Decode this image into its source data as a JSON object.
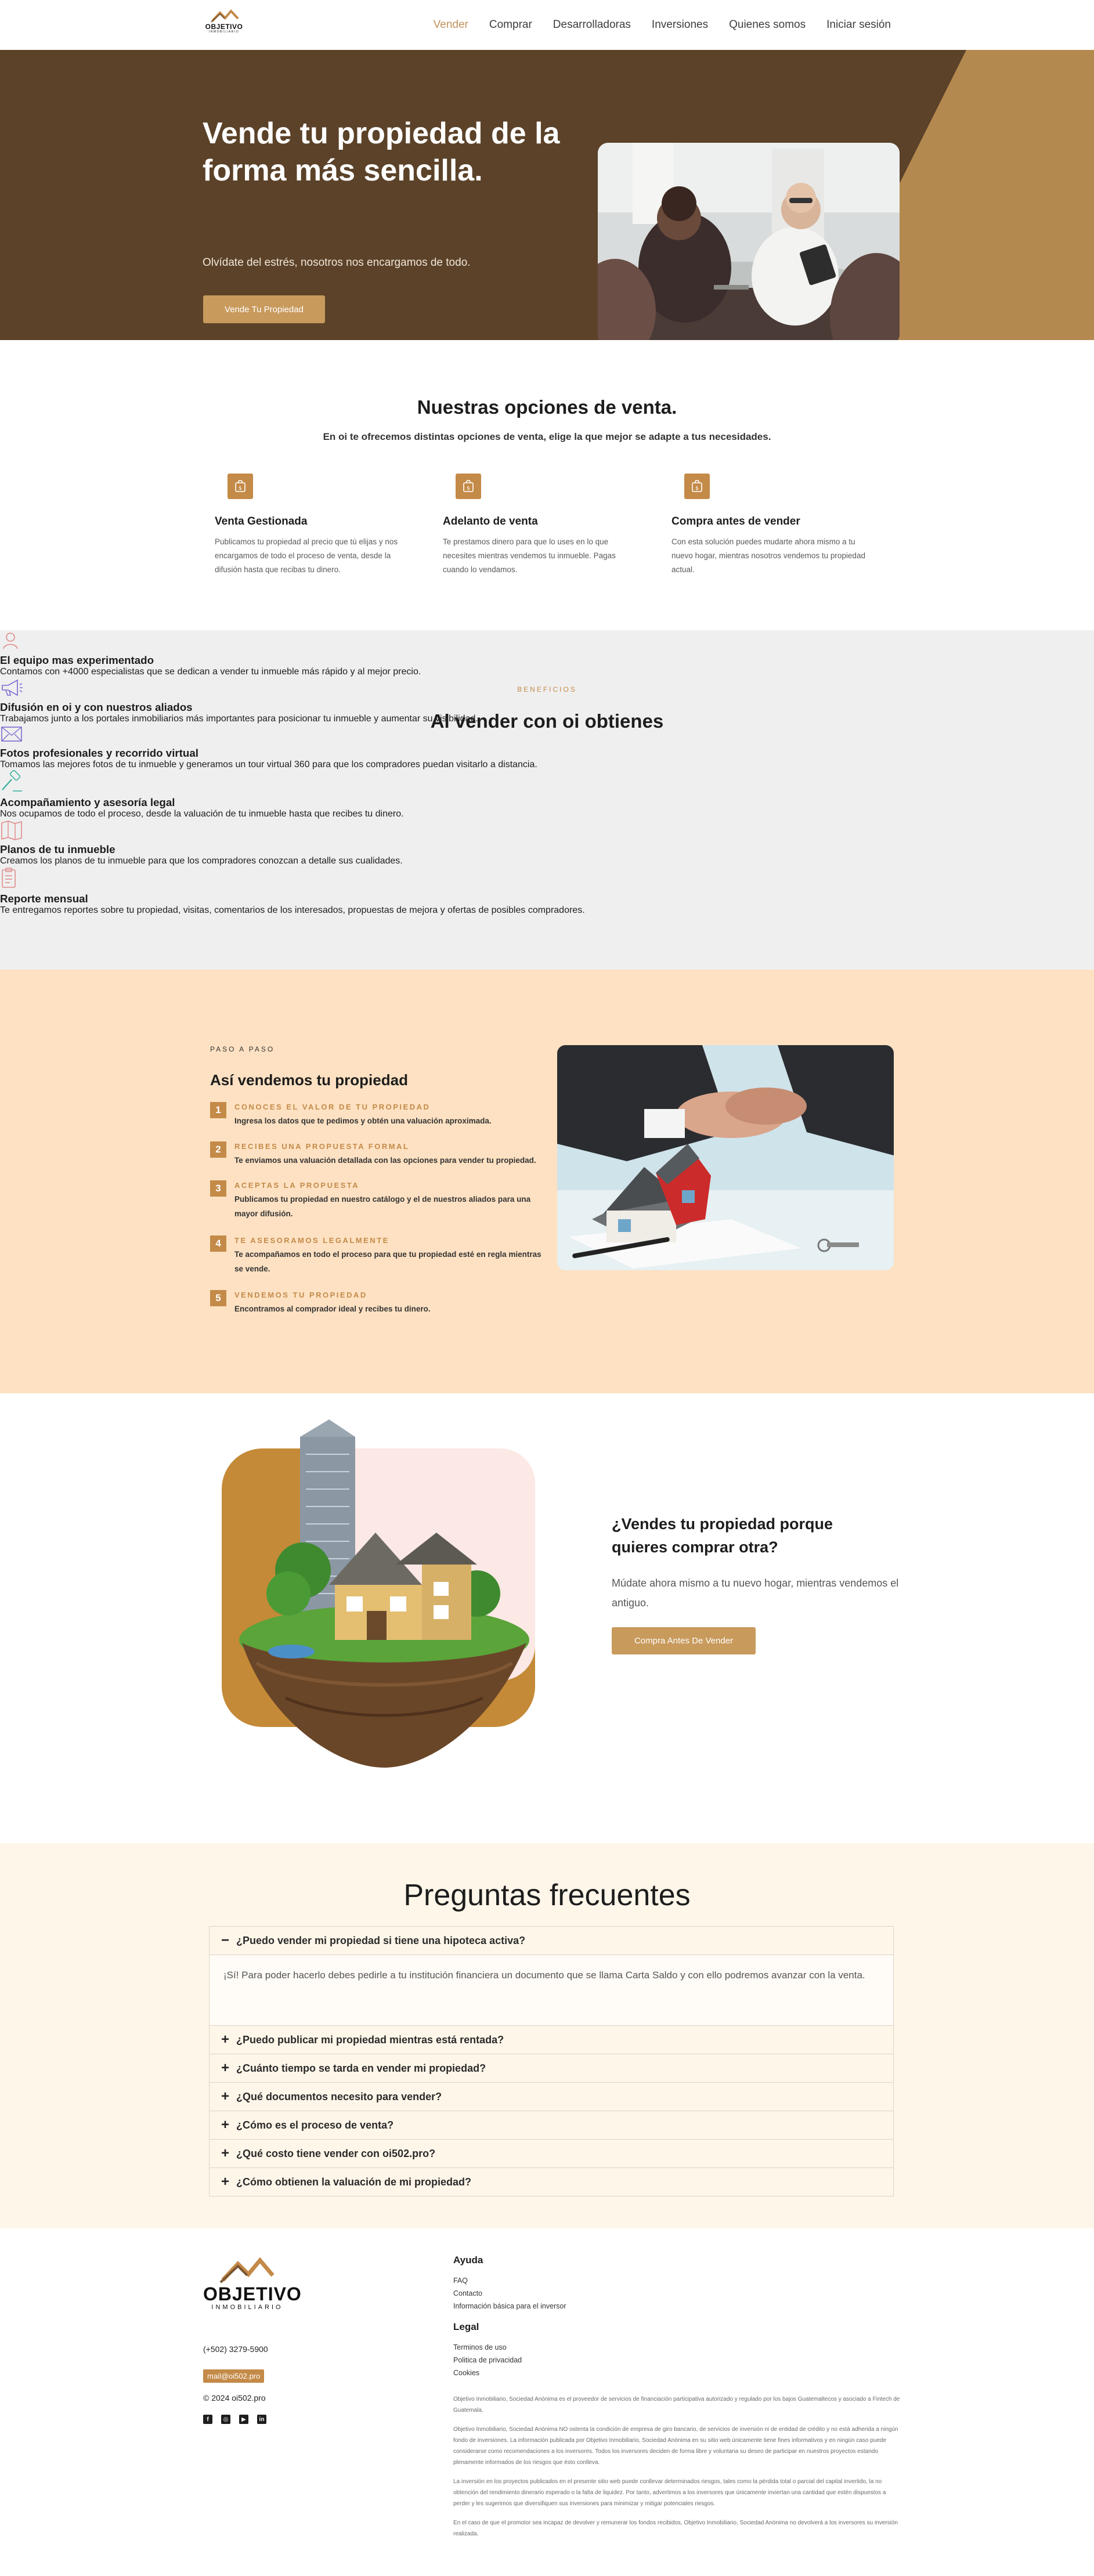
{
  "brand": {
    "name": "OBJETIVO",
    "tagline": "INMOBILIARIO",
    "colors": {
      "gold": "#c48a48",
      "hero_brown": "#5b4229",
      "peach": "#fde1c2",
      "cream": "#fef6e9",
      "grey": "#efefef"
    }
  },
  "nav": {
    "items": [
      {
        "label": "Vender",
        "active": true
      },
      {
        "label": "Comprar"
      },
      {
        "label": "Desarrolladoras"
      },
      {
        "label": "Inversiones"
      },
      {
        "label": "Quienes somos"
      },
      {
        "label": "Iniciar sesión"
      }
    ]
  },
  "hero": {
    "title": "Vende tu propiedad de la forma más sencilla.",
    "subtitle": "Olvídate del estrés, nosotros nos encargamos de todo.",
    "cta": "Vende Tu Propiedad"
  },
  "options": {
    "title": "Nuestras opciones de venta.",
    "lead": "En oi te ofrecemos distintas opciones de venta, elige la que mejor se adapte a tus necesidades.",
    "items": [
      {
        "icon": "money-bag-icon",
        "title": "Venta Gestionada",
        "text": "Publicamos tu propiedad al precio que tú elijas y nos encargamos de todo el proceso de venta, desde la difusión hasta que recibas tu dinero."
      },
      {
        "icon": "money-bag-icon",
        "title": "Adelanto de venta",
        "text": "Te prestamos dinero para que lo uses en lo que necesites mientras vendemos tu inmueble. Pagas cuando lo vendamos."
      },
      {
        "icon": "money-bag-icon",
        "title": "Compra antes de vender",
        "text": "Con esta solución puedes mudarte ahora mismo a tu nuevo hogar, mientras nosotros vendemos tu propiedad actual."
      }
    ]
  },
  "benefits": {
    "kicker": "BENEFICIOS",
    "title": "Al vender con oi obtienes",
    "items": [
      {
        "icon": "user-icon",
        "title": "El equipo mas experimentado",
        "text": "Contamos con +4000 especialistas que se dedican a vender tu inmueble más rápido y al mejor precio."
      },
      {
        "icon": "megaphone-icon",
        "title": "Difusión en oi y con nuestros aliados",
        "text": "Trabajamos junto a los portales inmobiliarios más importantes para posicionar tu inmueble y aumentar su visibilidad."
      },
      {
        "icon": "photos-icon",
        "title": "Fotos profesionales y recorrido virtual",
        "text": "Tomamos las mejores fotos de tu inmueble y generamos un tour virtual 360 para que los compradores puedan visitarlo a distancia."
      },
      {
        "icon": "gavel-icon",
        "title": "Acompañamiento y asesoría legal",
        "text": "Nos ocupamos de todo el proceso, desde la valuación de tu inmueble hasta que recibes tu dinero."
      },
      {
        "icon": "map-icon",
        "title": "Planos de tu inmueble",
        "text": "Creamos los planos de tu inmueble para que los compradores conozcan a detalle sus cualidades."
      },
      {
        "icon": "report-icon",
        "title": "Reporte mensual",
        "text": "Te entregamos reportes sobre tu propiedad, visitas, comentarios de los interesados, propuestas de mejora y ofertas de posibles compradores."
      }
    ]
  },
  "steps": {
    "kicker": "PASO A PASO",
    "title": "Así vendemos tu propiedad",
    "items": [
      {
        "num": "1",
        "title": "CONOCES EL VALOR DE TU PROPIEDAD",
        "text": "Ingresa los datos que te pedimos y obtén una valuación aproximada."
      },
      {
        "num": "2",
        "title": "RECIBES UNA PROPUESTA FORMAL",
        "text": "Te enviamos una valuación detallada con las opciones para vender tu propiedad."
      },
      {
        "num": "3",
        "title": "ACEPTAS LA PROPUESTA",
        "text": "Publicamos tu propiedad en nuestro catálogo y el de nuestros aliados para una mayor difusión."
      },
      {
        "num": "4",
        "title": "TE ASESORAMOS LEGALMENTE",
        "text": "Te acompañamos en todo el proceso para que tu propiedad esté en regla mientras se vende."
      },
      {
        "num": "5",
        "title": "VENDEMOS TU PROPIEDAD",
        "text": "Encontramos al comprador ideal y recibes tu dinero."
      }
    ]
  },
  "sellbuy": {
    "title": "¿Vendes tu propiedad porque quieres comprar otra?",
    "text": "Múdate ahora mismo a tu nuevo hogar, mientras vendemos el antiguo.",
    "cta": "Compra Antes De Vender"
  },
  "faq": {
    "title": "Preguntas frecuentes",
    "items": [
      {
        "q": "¿Puedo vender mi propiedad si tiene una hipoteca activa?",
        "open": true,
        "a": "¡Sí! Para poder hacerlo debes pedirle a tu institución financiera un documento que se llama Carta Saldo y con ello podremos avanzar con la venta."
      },
      {
        "q": "¿Puedo publicar mi propiedad mientras está rentada?"
      },
      {
        "q": "¿Cuánto tiempo se tarda en vender mi propiedad?"
      },
      {
        "q": "¿Qué documentos necesito para vender?"
      },
      {
        "q": "¿Cómo es el proceso de venta?"
      },
      {
        "q": "¿Qué costo tiene vender con oi502.pro?"
      },
      {
        "q": "¿Cómo obtienen la valuación de mi propiedad?"
      }
    ]
  },
  "footer": {
    "phone": "(+502) 3279-5900",
    "email": "mail@oi502.pro",
    "copyright": "© 2024 oi502.pro",
    "social": [
      {
        "icon": "facebook-icon",
        "glyph": "f"
      },
      {
        "icon": "instagram-icon",
        "glyph": "◎"
      },
      {
        "icon": "youtube-icon",
        "glyph": "▶"
      },
      {
        "icon": "linkedin-icon",
        "glyph": "in"
      }
    ],
    "help": {
      "title": "Ayuda",
      "links": [
        "FAQ",
        "Contacto",
        "Información básica para el inversor"
      ]
    },
    "legal": {
      "title": "Legal",
      "links": [
        "Terminos de uso",
        "Politica de privacidad",
        "Cookies"
      ]
    },
    "disclaimers": [
      "Objetivo Inmobiliario, Sociedad Anónima es el proveedor de servicios de financiación participativa autorizado y regulado por los bajos Guatemaltecos y asociado a Fintech de Guatemala.",
      "Objetivo Inmobiliario, Sociedad Anónima NO ostenta la condición de empresa de giro bancario, de servicios de inversión ni de entidad de crédito y no está adherida a ningún fondo de inversiones. La información publicada por Objetivo Inmobiliario, Sociedad Anónima en su sitio web únicamente tiene fines informativos y en ningún caso puede considerarse como recomendaciones a los inversores. Todos los inversores deciden de forma libre y voluntaria su deseo de participar en nuestros proyectos estando plenamente informados de los riesgos que ésto conlleva.",
      "La inversión en los proyectos publicados en el presente sitio web puede conllevar determinados riesgos, tales como la pérdida total o parcial del capital invertido, la no obtención del rendimiento dinerario esperado o la falta de liquidez. Por tanto, advertimos a los inversores que únicamente inviertan una cantidad que estén dispuestos a perder y les sugerimos que diversifiquen sus inversiones para minimizar y mitigar potenciales riesgos.",
      "En el caso de que el promotor sea incapaz de devolver y remunerar los fondos recibidos, Objetivo Inmobiliario, Sociedad Anónima no devolverá a los inversores su inversión realizada."
    ]
  }
}
